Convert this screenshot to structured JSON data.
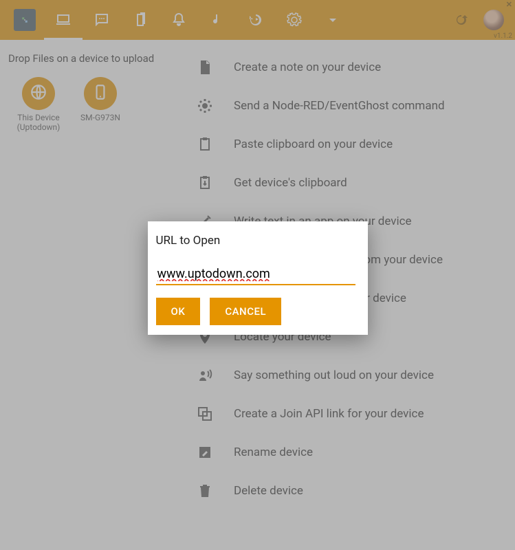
{
  "version": "v1.1.2",
  "sidebar": {
    "drop_hint": "Drop Files on a device to upload",
    "devices": [
      {
        "name": "This Device (Uptodown)"
      },
      {
        "name": "SM-G973N"
      }
    ]
  },
  "actions": [
    {
      "label": "Create a note on your device"
    },
    {
      "label": "Send a Node-RED/EventGhost command"
    },
    {
      "label": "Paste clipboard on your device"
    },
    {
      "label": "Get device's clipboard"
    },
    {
      "label": "Write text in an app on your device"
    },
    {
      "label": "Send an SMS message from your device"
    },
    {
      "label": "Take a screenshot on your device"
    },
    {
      "label": "Locate your device"
    },
    {
      "label": "Say something out loud on your device"
    },
    {
      "label": "Create a Join API link for your device"
    },
    {
      "label": "Rename device"
    },
    {
      "label": "Delete device"
    }
  ],
  "dialog": {
    "title": "URL to Open",
    "value": "www.uptodown.com",
    "ok": "OK",
    "cancel": "CANCEL"
  }
}
